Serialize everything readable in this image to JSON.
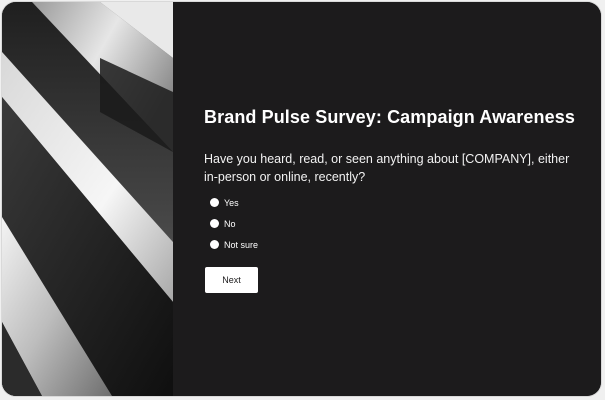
{
  "survey": {
    "title": "Brand Pulse Survey: Campaign Awareness",
    "question": "Have you heard, read, or seen anything about [COMPANY], either in-person or online, recently?",
    "options": [
      {
        "label": "Yes"
      },
      {
        "label": "No"
      },
      {
        "label": "Not sure"
      }
    ],
    "next_label": "Next"
  },
  "colors": {
    "panel_background": "#1c1b1c",
    "text": "#ffffff",
    "button_background": "#ffffff"
  },
  "icons": [
    "abstract-diagonal-stripes-image",
    "radio-unselected-icon"
  ]
}
